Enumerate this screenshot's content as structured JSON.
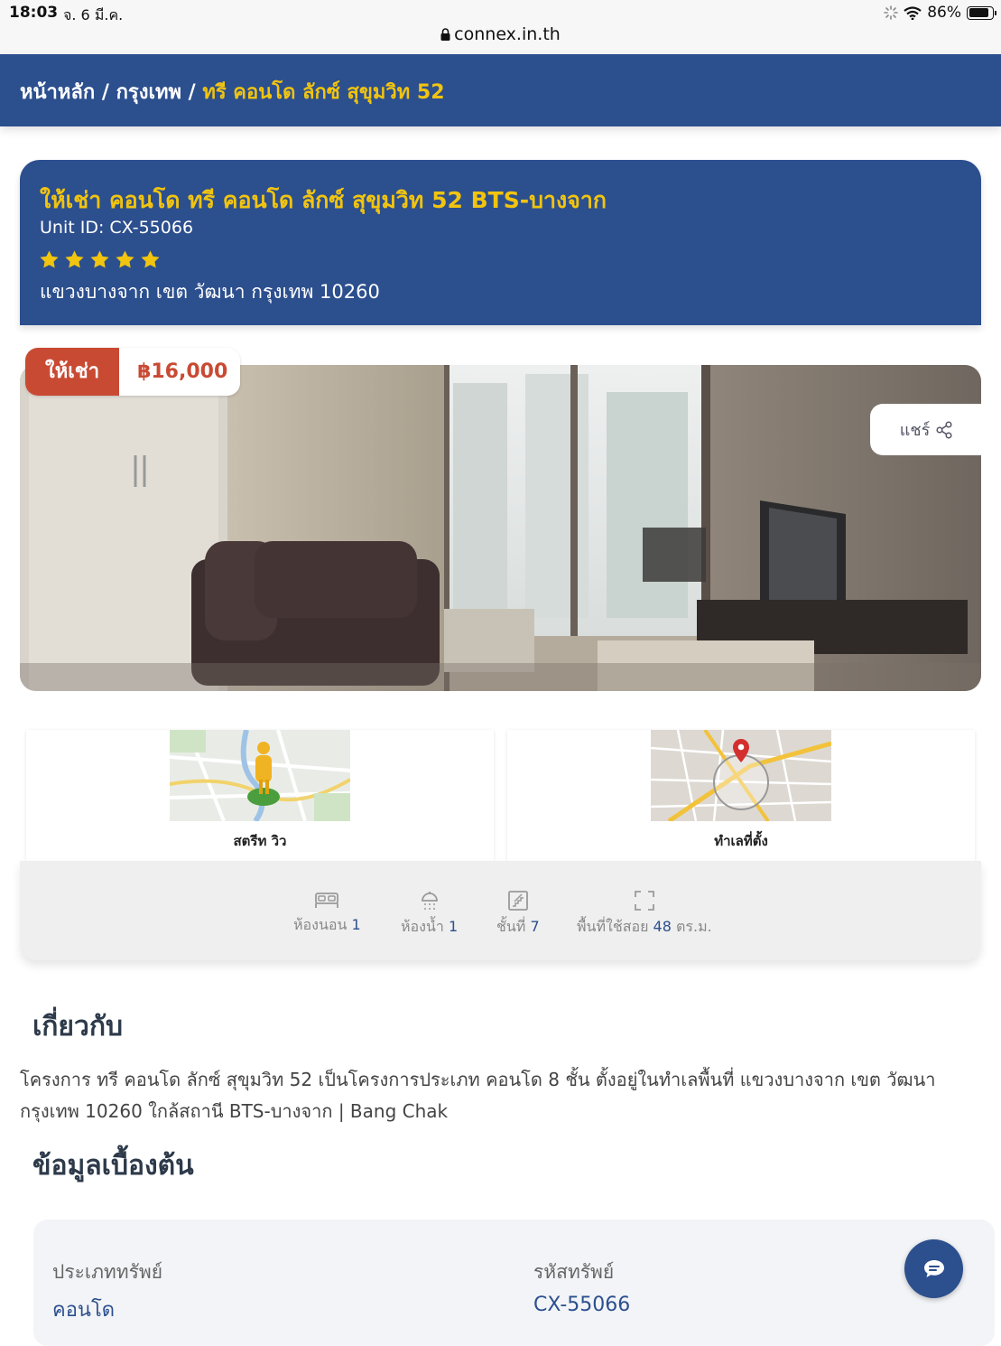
{
  "status_bar": {
    "time": "18:03",
    "date": "จ. 6 มี.ค.",
    "battery": "86%",
    "url": "connex.in.th"
  },
  "breadcrumb": {
    "home": "หน้าหลัก",
    "city": "กรุงเทพ",
    "separator": " / ",
    "current": "ทรี คอนโด ลักซ์ สุขุมวิท 52"
  },
  "listing": {
    "title": "ให้เช่า คอนโด ทรี คอนโด ลักซ์ สุขุมวิท 52 BTS-บางจาก",
    "unit_id": "Unit ID: CX-55066",
    "rating": 5,
    "address": "แขวงบางจาก เขต วัฒนา กรุงเทพ 10260",
    "badge_type": "ให้เช่า",
    "price": "฿16,000",
    "share_label": "แชร์"
  },
  "maps": {
    "street_view": "สตรีท วิว",
    "location": "ทำเลที่ตั้ง"
  },
  "features": {
    "bedroom_label": "ห้องนอน",
    "bedroom_value": "1",
    "bathroom_label": "ห้องน้ำ",
    "bathroom_value": "1",
    "floor_label": "ชั้นที่",
    "floor_value": "7",
    "area_label": "พื้นที่ใช้สอย",
    "area_value": "48",
    "area_unit": "ตร.ม."
  },
  "about": {
    "heading": "เกี่ยวกับ",
    "text": "โครงการ ทรี คอนโด ลักซ์ สุขุมวิท 52 เป็นโครงการประเภท คอนโด 8 ชั้น ตั้งอยู่ในทำเลพื้นที่ แขวงบางจาก เขต วัฒนา กรุงเทพ 10260 ใกล้สถานี BTS-บางจาก | Bang Chak"
  },
  "basic_info": {
    "heading": "ข้อมูลเบื้องต้น",
    "property_type_label": "ประเภททรัพย์",
    "property_type_value": "คอนโด",
    "property_code_label": "รหัสทรัพย์",
    "property_code_value": "CX-55066"
  },
  "colors": {
    "primary": "#2c4f8e",
    "accent": "#f1c40f",
    "badge": "#c94a33"
  },
  "icons": [
    "lock-icon",
    "wifi-icon",
    "battery-icon",
    "star-icon",
    "share-icon",
    "bed-icon",
    "shower-icon",
    "stairs-icon",
    "area-icon",
    "chat-icon"
  ]
}
